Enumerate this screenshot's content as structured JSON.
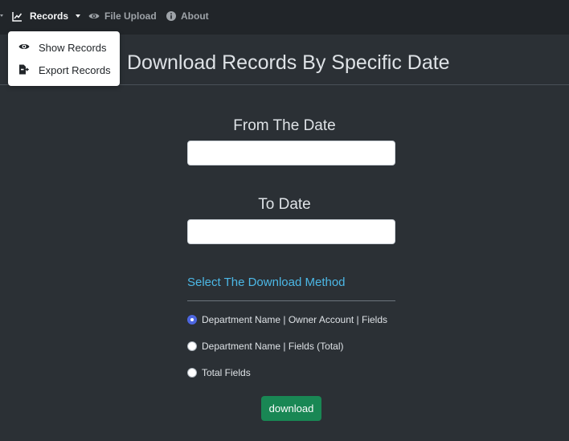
{
  "nav": {
    "records": "Records",
    "file_upload": "File Upload",
    "about": "About"
  },
  "dropdown": {
    "items": [
      {
        "label": "Show Records",
        "icon": "eye-icon"
      },
      {
        "label": "Export Records",
        "icon": "export-icon"
      }
    ]
  },
  "page": {
    "title": "Download Records By Specific Date"
  },
  "form": {
    "from_label": "From The Date",
    "from_value": "",
    "to_label": "To Date",
    "to_value": "",
    "method_title": "Select The Download Method",
    "methods": [
      {
        "label": "Department Name | Owner Account | Fields",
        "checked": true
      },
      {
        "label": "Department Name | Fields (Total)",
        "checked": false
      },
      {
        "label": "Total Fields",
        "checked": false
      }
    ],
    "download_label": "download"
  },
  "colors": {
    "background": "#212529",
    "panel": "#2b3035",
    "accent_link": "#4cb8e6",
    "radio_checked": "#4d66e0",
    "button": "#198754"
  }
}
